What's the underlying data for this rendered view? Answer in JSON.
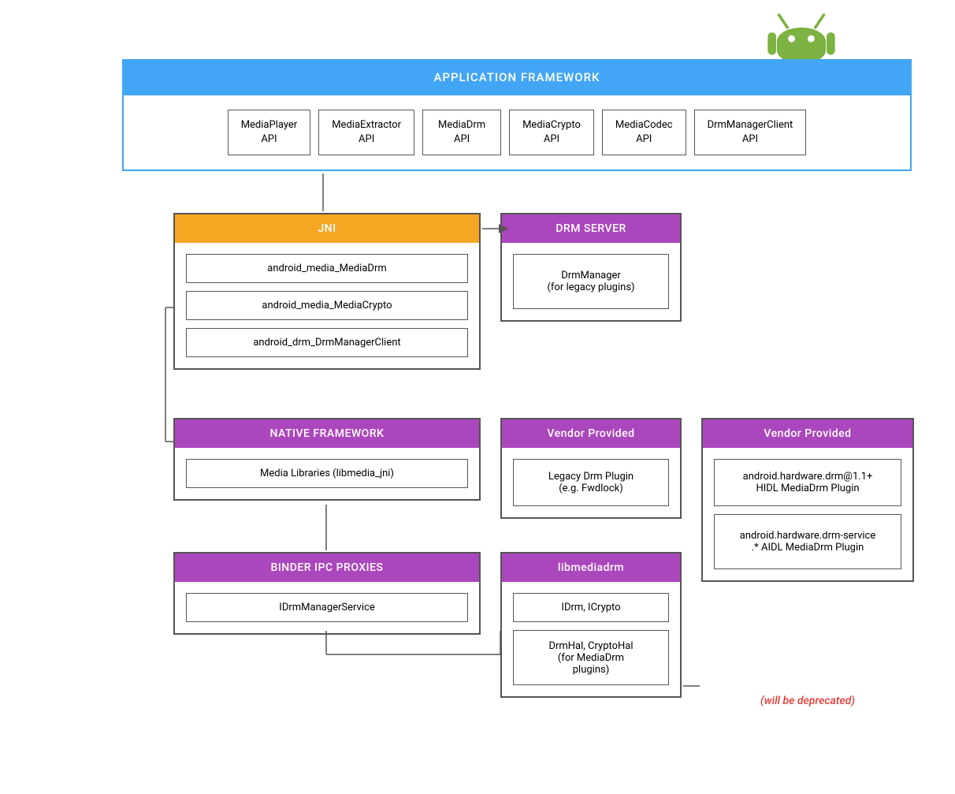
{
  "android_logo": {
    "label": "Android"
  },
  "app_framework": {
    "header": "APPLICATION FRAMEWORK",
    "apis": [
      {
        "name": "MediaPlayer",
        "suffix": "API"
      },
      {
        "name": "MediaExtractor",
        "suffix": "API"
      },
      {
        "name": "MediaDrm",
        "suffix": "API"
      },
      {
        "name": "MediaCrypto",
        "suffix": "API"
      },
      {
        "name": "MediaCodec",
        "suffix": "API"
      },
      {
        "name": "DrmManagerClient",
        "suffix": "API"
      }
    ]
  },
  "jni": {
    "header": "JNI",
    "items": [
      "android_media_MediaDrm",
      "android_media_MediaCrypto",
      "android_drm_DrmManagerClient"
    ]
  },
  "native_framework": {
    "header": "NATIVE FRAMEWORK",
    "items": [
      "Media Libraries (libmedia_jni)"
    ]
  },
  "binder_ipc": {
    "header": "BINDER IPC PROXIES",
    "items": [
      "IDrmManagerService"
    ]
  },
  "drm_server": {
    "header": "DRM SERVER",
    "items": [
      "DrmManager\n(for legacy plugins)"
    ]
  },
  "vendor_left": {
    "header": "Vendor Provided",
    "items": [
      "Legacy Drm Plugin\n(e.g. Fwdlock)"
    ]
  },
  "libmediadrm": {
    "header": "libmediadrm",
    "items": [
      "IDrm, ICrypto",
      "DrmHal, CryptoHal\n(for MediaDrm\nplugins)"
    ]
  },
  "vendor_right": {
    "header": "Vendor Provided",
    "items": [
      "android.hardware.drm@1.1+\nHIDL MediaDrm Plugin",
      "android.hardware.drm-service\n.* AIDL MediaDrm Plugin"
    ]
  },
  "deprecated": {
    "text": "(will be deprecated)"
  },
  "colors": {
    "blue": "#42a5f5",
    "orange": "#f5a623",
    "purple": "#ab47bc",
    "border": "#555555",
    "red": "#e53935"
  }
}
